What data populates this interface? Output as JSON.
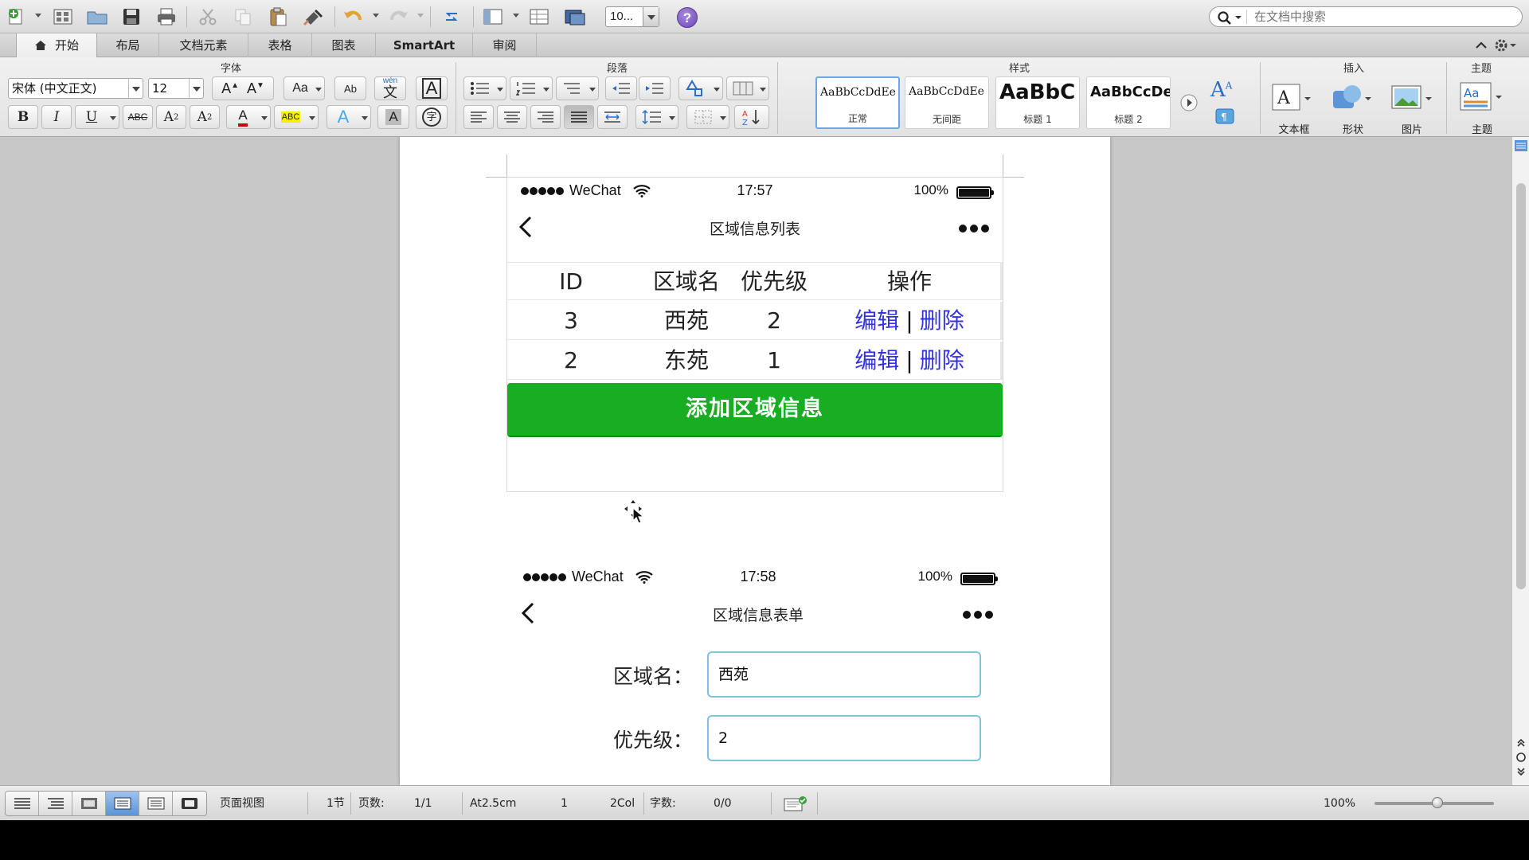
{
  "toolbar": {
    "zoom_value": "10...",
    "help_label": "?",
    "search_placeholder": "在文档中搜索"
  },
  "tabs": [
    {
      "label": "开始",
      "active": true
    },
    {
      "label": "布局"
    },
    {
      "label": "文档元素"
    },
    {
      "label": "表格"
    },
    {
      "label": "图表"
    },
    {
      "label": "SmartArt"
    },
    {
      "label": "审阅"
    }
  ],
  "ribbon": {
    "groups": {
      "font": "字体",
      "paragraph": "段落",
      "styles": "样式",
      "insert": "插入",
      "theme": "主题"
    },
    "font_name": "宋体 (中文正文)",
    "font_size": "12",
    "font_buttons": {
      "grow": "A",
      "shrink": "A",
      "change_case": "Aa",
      "spell": "Ab",
      "phonetic_top": "wén",
      "phonetic_char": "文",
      "char_border": "A",
      "bold": "B",
      "italic": "I",
      "underline": "U",
      "strike": "ABC",
      "superscript": "A",
      "subscript": "A",
      "font_color": "A",
      "highlight": "ABC",
      "text_effect": "A",
      "char_shade": "A",
      "enclose": "字"
    },
    "styles": [
      {
        "sample": "AaBbCcDdEe",
        "name": "正常",
        "selected": true
      },
      {
        "sample": "AaBbCcDdEe",
        "name": "无间距"
      },
      {
        "sample": "AaBbC",
        "name": "标题 1"
      },
      {
        "sample": "AaBbCcDe",
        "name": "标题 2"
      }
    ],
    "styles_pane_label": "A",
    "insert_items": [
      "文本框",
      "形状",
      "图片"
    ],
    "textbox_glyph": "A",
    "theme_item": "主题",
    "theme_glyph": "Aa"
  },
  "document": {
    "shot1": {
      "status": {
        "carrier": "WeChat",
        "time": "17:57",
        "battery_pct": "100%"
      },
      "title": "区域信息列表",
      "table": {
        "headers": [
          "ID",
          "区域名",
          "优先级",
          "操作"
        ],
        "rows": [
          {
            "id": "3",
            "name": "西苑",
            "priority": "2",
            "edit": "编辑",
            "sep": "|",
            "delete": "删除"
          },
          {
            "id": "2",
            "name": "东苑",
            "priority": "1",
            "edit": "编辑",
            "sep": "|",
            "delete": "删除"
          }
        ]
      },
      "add_button": "添加区域信息"
    },
    "shot2": {
      "status": {
        "carrier": "WeChat",
        "time": "17:58",
        "battery_pct": "100%"
      },
      "title": "区域信息表单",
      "fields": [
        {
          "label": "区域名：",
          "value": "西苑"
        },
        {
          "label": "优先级：",
          "value": "2"
        }
      ]
    }
  },
  "statusbar": {
    "view": "页面视图",
    "section": "1节",
    "pages_label": "页数:",
    "pages_value": "1/1",
    "position": "At2.5cm",
    "line": "1",
    "col": "2Col",
    "words_label": "字数:",
    "words_value": "0/0",
    "zoom": "100%"
  },
  "colors": {
    "accent_green": "#19ad24",
    "link_blue": "#3232e0",
    "field_border": "#7ec3d9"
  }
}
